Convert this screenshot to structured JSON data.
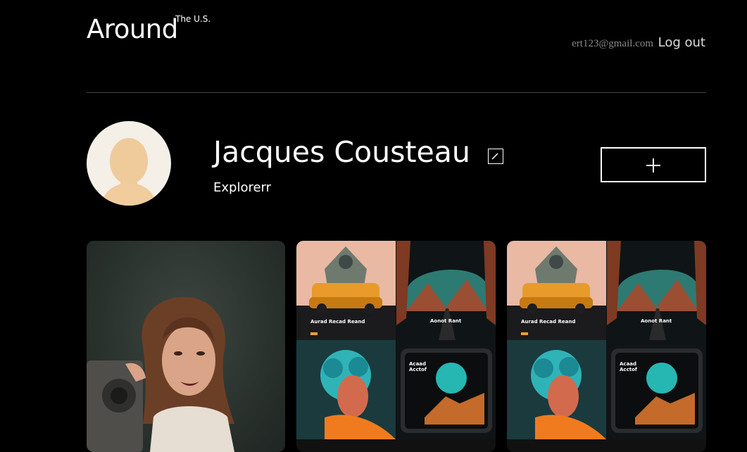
{
  "header": {
    "logo": "Around",
    "logo_sup": "The U.S.",
    "email": "ert123@gmail.com",
    "logout": "Log out"
  },
  "profile": {
    "name": "Jacques Cousteau",
    "role": "Explorerr"
  },
  "gallery": {
    "tiles": [
      {
        "label": "Aurad Recad Reand"
      },
      {
        "label": "Aonot Rant"
      },
      {
        "label": "Acaad Acctof"
      }
    ]
  }
}
